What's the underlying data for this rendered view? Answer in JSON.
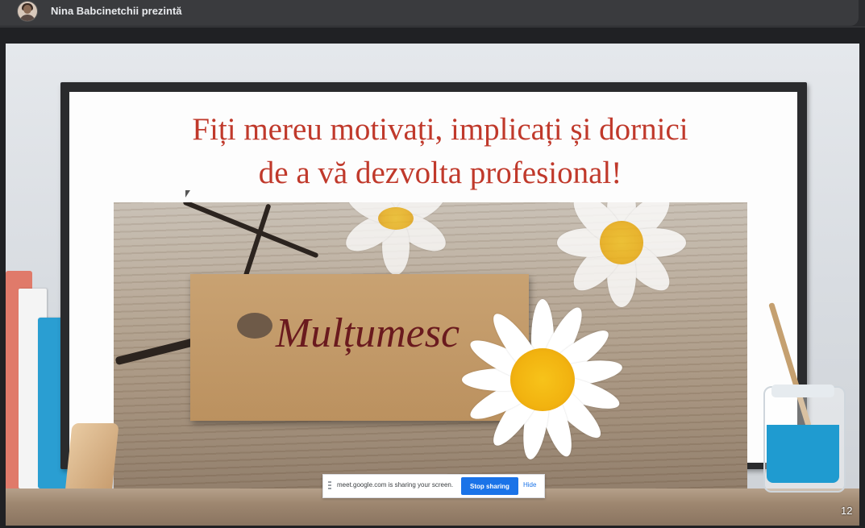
{
  "header": {
    "presenter_text": "Nina Babcinetchii prezintă"
  },
  "slide": {
    "title_line1": "Fiți mereu motivați, implicați și dornici",
    "title_line2": "de a vă dezvolta profesional!",
    "tag_text": "Mulțumesc",
    "page_number": "12"
  },
  "screen_share_bar": {
    "message": "meet.google.com is sharing your screen.",
    "stop_label": "Stop sharing",
    "hide_label": "Hide"
  },
  "colors": {
    "title": "#c0392b",
    "tag_text": "#6a1a1e",
    "stop_button": "#1a73e8"
  }
}
